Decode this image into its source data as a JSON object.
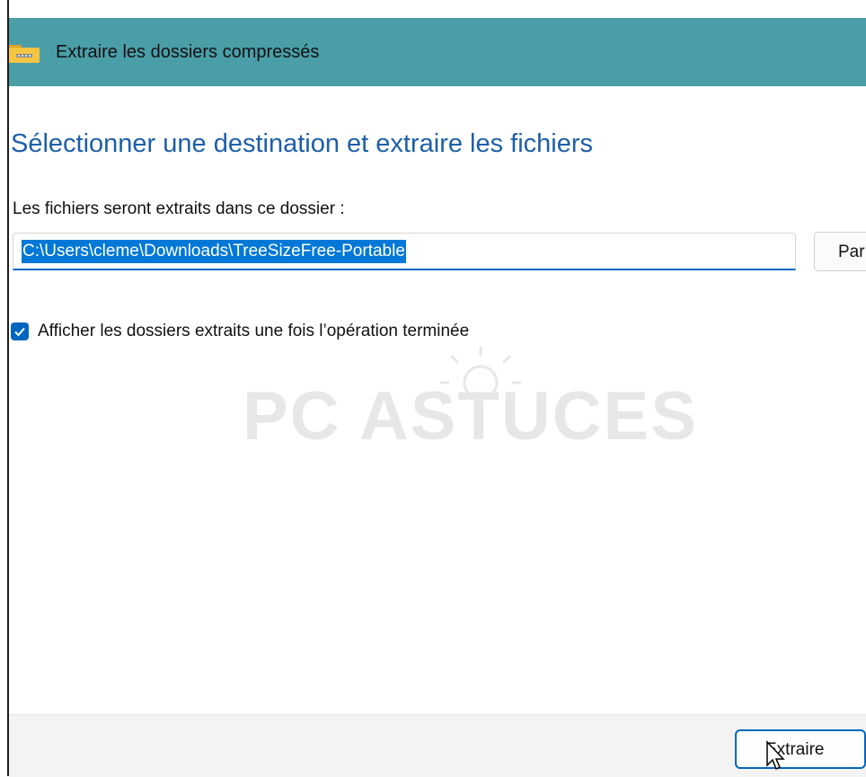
{
  "window": {
    "title": "Extraire les dossiers compressés"
  },
  "main": {
    "heading": "Sélectionner une destination et extraire les fichiers",
    "path_label": "Les fichiers seront extraits dans ce dossier :",
    "path_value": "C:\\Users\\cleme\\Downloads\\TreeSizeFree-Portable",
    "browse_label": "Par",
    "show_folders_checkbox": {
      "label": "Afficher les dossiers extraits une fois l’opération terminée",
      "checked": true
    }
  },
  "watermark": {
    "text": "PC ASTUCES"
  },
  "footer": {
    "extract_label": "Extraire"
  },
  "colors": {
    "titlebar": "#4a9ea8",
    "accent": "#0067c0",
    "heading": "#1d5fa8"
  }
}
